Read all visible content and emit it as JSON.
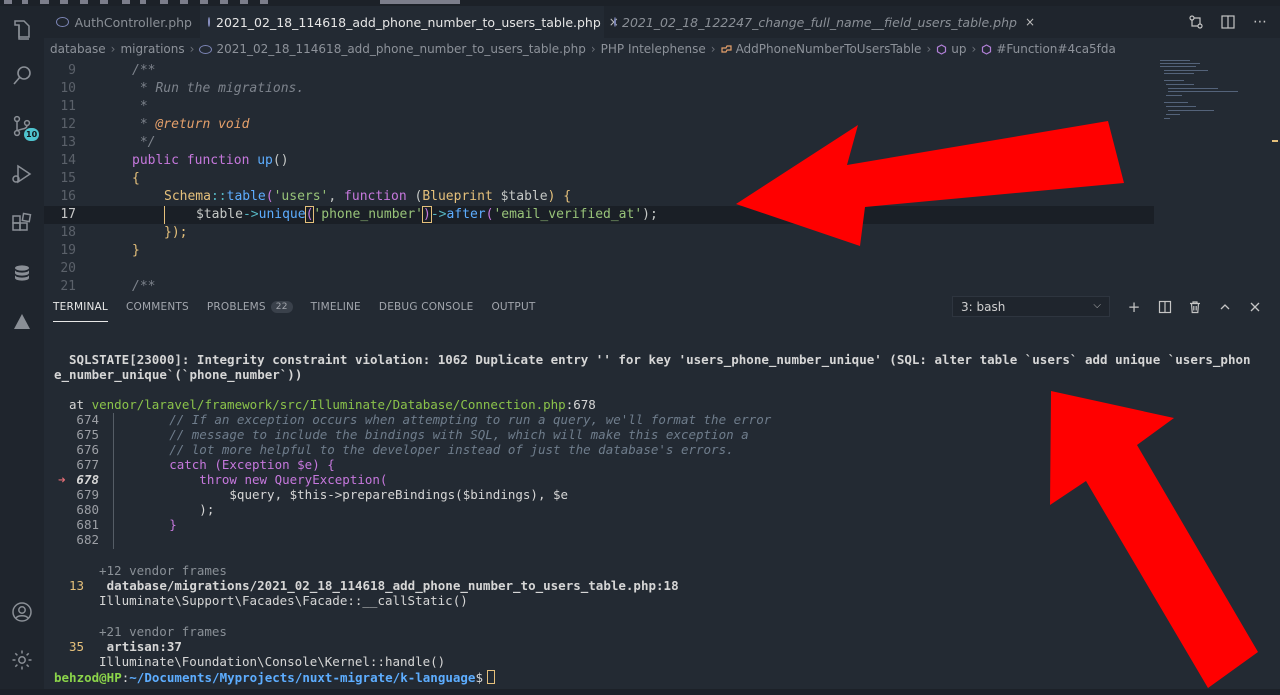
{
  "tabs": [
    {
      "label": "AuthController.php",
      "active": false,
      "italic": false,
      "closable": false
    },
    {
      "label": "2021_02_18_114618_add_phone_number_to_users_table.php",
      "active": true,
      "italic": false,
      "closable": true
    },
    {
      "label": "2021_02_18_122247_change_full_name__field_users_table.php",
      "active": false,
      "italic": true,
      "closable": true
    }
  ],
  "close_glyph": "×",
  "breadcrumb": [
    "database",
    "migrations",
    "2021_02_18_114618_add_phone_number_to_users_table.php",
    "PHP Intelephense",
    "AddPhoneNumberToUsersTable",
    "up",
    "#Function#4ca5fda"
  ],
  "activity": {
    "scm_badge": "10",
    "icons": [
      "files-icon",
      "search-icon",
      "source-control-icon",
      "run-debug-icon",
      "extensions-icon",
      "database-icon",
      "deploy-icon",
      "account-icon",
      "settings-icon"
    ]
  },
  "editor": {
    "line_numbers": [
      "9",
      "10",
      "11",
      "12",
      "13",
      "14",
      "15",
      "16",
      "17",
      "18",
      "19",
      "20",
      "21"
    ],
    "current_line": "17",
    "lines": {
      "l9": "/**",
      "l10": " * Run the migrations.",
      "l11": " *",
      "l12_a": " * ",
      "l12_b": "@return",
      "l12_c": " void",
      "l13": " */",
      "l14_a": "public function ",
      "l14_b": "up",
      "l14_c": "()",
      "l15": "{",
      "l16_a": "Schema",
      "l16_b": "::",
      "l16_c": "table",
      "l16_d": "(",
      "l16_e": "'users'",
      "l16_f": ", ",
      "l16_g": "function",
      "l16_h": " (",
      "l16_i": "Blueprint",
      "l16_j": " $table",
      "l16_k": ") {",
      "l17_a": "$table",
      "l17_b": "->",
      "l17_c": "unique",
      "l17_d": "(",
      "l17_e": "'phone_number'",
      "l17_f": ")",
      "l17_g": "->",
      "l17_h": "after",
      "l17_i": "(",
      "l17_j": "'email_verified_at'",
      "l17_k": ");",
      "l18": "});",
      "l19": "}",
      "l21": "/**"
    }
  },
  "panel": {
    "tabs": [
      "TERMINAL",
      "COMMENTS",
      "PROBLEMS",
      "TIMELINE",
      "DEBUG CONSOLE",
      "OUTPUT"
    ],
    "problems_count": "22",
    "terminal_select": "3: bash"
  },
  "terminal": {
    "error_line1": "SQLSTATE[23000]: Integrity constraint violation: 1062 Duplicate entry '' for key 'users_phone_number_unique' (SQL: alter table `users` add unique `users_phon",
    "error_line2": "e_number_unique`(`phone_number`))",
    "at_prefix": "at ",
    "at_path": "vendor/laravel/framework/src/Illuminate/Database/Connection.php",
    "at_line": ":678",
    "snippet": [
      {
        "n": "674",
        "code": "        // If an exception occurs when attempting to run a query, we'll format the error"
      },
      {
        "n": "675",
        "code": "        // message to include the bindings with SQL, which will make this exception a"
      },
      {
        "n": "676",
        "code": "        // lot more helpful to the developer instead of just the database's errors."
      },
      {
        "n": "677",
        "code": "        catch (Exception $e) {"
      },
      {
        "n": "678",
        "code": "            throw new QueryException("
      },
      {
        "n": "679",
        "code": "                $query, $this->prepareBindings($bindings), $e"
      },
      {
        "n": "680",
        "code": "            );"
      },
      {
        "n": "681",
        "code": "        }"
      },
      {
        "n": "682",
        "code": ""
      }
    ],
    "marker": "➜",
    "vendor1": "+12 vendor frames",
    "frame1_num": "13",
    "frame1_file": "database/migrations/2021_02_18_114618_add_phone_number_to_users_table.php",
    "frame1_line": ":18",
    "frame1_call": "Illuminate\\Support\\Facades\\Facade::__callStatic()",
    "vendor2": "+21 vendor frames",
    "frame2_num": "35",
    "frame2_file": "artisan",
    "frame2_line": ":37",
    "frame2_call": "Illuminate\\Foundation\\Console\\Kernel::handle()",
    "prompt_user": "behzod@HP",
    "prompt_colon": ":",
    "prompt_path": "~/Documents/Myprojects/nuxt-migrate/k-language",
    "prompt_sign": "$"
  },
  "colors": {
    "arrow": "#ff0000",
    "accent": "#4fc4cf"
  }
}
